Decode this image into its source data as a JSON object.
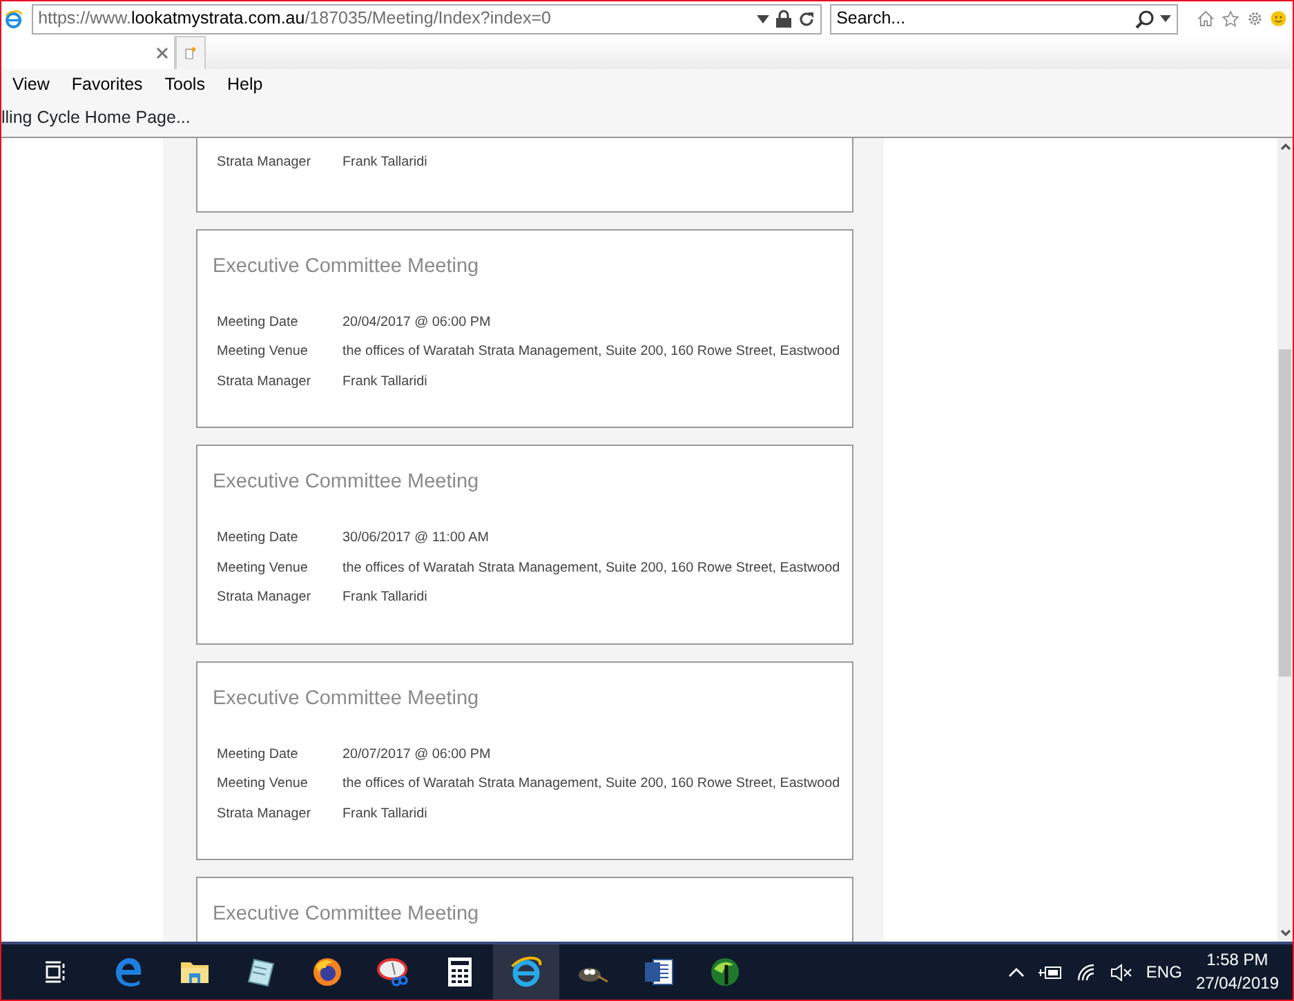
{
  "browser": {
    "address": {
      "scheme": "https://www.",
      "domain": "lookatmystrata.com.au",
      "path": "/187035/Meeting/Index?index=0"
    },
    "search": {
      "placeholder": "Search..."
    },
    "menu": [
      "View",
      "Favorites",
      "Tools",
      "Help"
    ],
    "favorites": [
      "lling Cycle Home Page..."
    ]
  },
  "meetings": [
    {
      "kind": "cut-top",
      "fields": [
        {
          "label": "Strata Manager",
          "value": "Frank Tallaridi"
        }
      ]
    },
    {
      "kind": "full",
      "title": "Executive Committee Meeting",
      "fields": [
        {
          "label": "Meeting Date",
          "value": "20/04/2017 @ 06:00 PM"
        },
        {
          "label": "Meeting Venue",
          "value": "the offices of Waratah Strata Management, Suite 200, 160 Rowe Street, Eastwood"
        },
        {
          "label": "Strata Manager",
          "value": "Frank Tallaridi"
        }
      ]
    },
    {
      "kind": "full",
      "title": "Executive Committee Meeting",
      "fields": [
        {
          "label": "Meeting Date",
          "value": "30/06/2017 @ 11:00 AM"
        },
        {
          "label": "Meeting Venue",
          "value": "the offices of Waratah Strata Management, Suite 200, 160 Rowe Street, Eastwood"
        },
        {
          "label": "Strata Manager",
          "value": "Frank Tallaridi"
        }
      ]
    },
    {
      "kind": "full",
      "title": "Executive Committee Meeting",
      "fields": [
        {
          "label": "Meeting Date",
          "value": "20/07/2017 @ 06:00 PM"
        },
        {
          "label": "Meeting Venue",
          "value": "the offices of Waratah Strata Management, Suite 200, 160 Rowe Street, Eastwood"
        },
        {
          "label": "Strata Manager",
          "value": "Frank Tallaridi"
        }
      ]
    },
    {
      "kind": "cut-bottom",
      "title": "Executive Committee Meeting"
    }
  ],
  "taskbar": {
    "apps": [
      {
        "kind": "taskview",
        "selected": false
      },
      {
        "kind": "edge",
        "selected": false
      },
      {
        "kind": "folder",
        "selected": false
      },
      {
        "kind": "notepad",
        "selected": false
      },
      {
        "kind": "firefox",
        "selected": false
      },
      {
        "kind": "scissors",
        "selected": false
      },
      {
        "kind": "calculator",
        "selected": false
      },
      {
        "kind": "ie",
        "selected": true
      },
      {
        "kind": "mascot",
        "selected": false
      },
      {
        "kind": "word",
        "selected": false
      },
      {
        "kind": "globe",
        "selected": false
      }
    ],
    "language": "ENG",
    "time": "1:58 PM",
    "date": "27/04/2019"
  }
}
